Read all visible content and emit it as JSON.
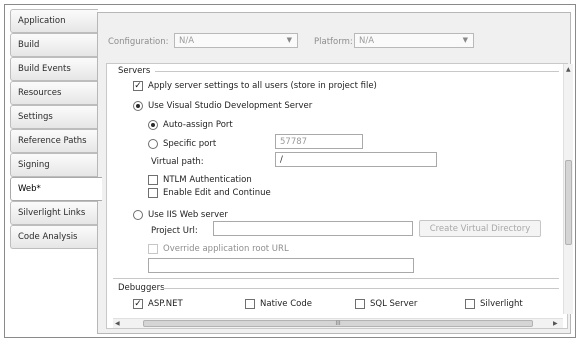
{
  "tabs": [
    {
      "label": "Application"
    },
    {
      "label": "Build"
    },
    {
      "label": "Build Events"
    },
    {
      "label": "Resources"
    },
    {
      "label": "Settings"
    },
    {
      "label": "Reference Paths"
    },
    {
      "label": "Signing"
    },
    {
      "label": "Web*",
      "active": true
    },
    {
      "label": "Silverlight Links"
    },
    {
      "label": "Code Analysis"
    }
  ],
  "configuration": {
    "label": "Configuration:",
    "value": "N/A"
  },
  "platform": {
    "label": "Platform:",
    "value": "N/A"
  },
  "servers": {
    "group_label": "Servers",
    "apply_all": {
      "label": "Apply server settings to all users (store in project file)",
      "checked": true
    },
    "vs_dev_server": {
      "label": "Use Visual Studio Development Server",
      "selected": true
    },
    "auto_port": {
      "label": "Auto-assign Port",
      "selected": true
    },
    "specific_port": {
      "label": "Specific port",
      "value": "57787"
    },
    "virtual_path": {
      "label": "Virtual path:",
      "value": "/"
    },
    "ntlm": {
      "label": "NTLM Authentication",
      "checked": false
    },
    "edit_continue": {
      "label": "Enable Edit and Continue",
      "checked": false
    },
    "iis": {
      "label": "Use IIS Web server",
      "selected": false
    },
    "project_url": {
      "label": "Project Url:",
      "value": ""
    },
    "create_vdir": {
      "label": "Create Virtual Directory"
    },
    "override_root": {
      "label": "Override application root URL",
      "checked": false
    },
    "override_value": ""
  },
  "debuggers": {
    "group_label": "Debuggers",
    "items": [
      {
        "label": "ASP.NET",
        "checked": true
      },
      {
        "label": "Native Code",
        "checked": false
      },
      {
        "label": "SQL Server",
        "checked": false
      },
      {
        "label": "Silverlight",
        "checked": false
      }
    ]
  },
  "scroll": {
    "thumb_glyph": "III"
  }
}
